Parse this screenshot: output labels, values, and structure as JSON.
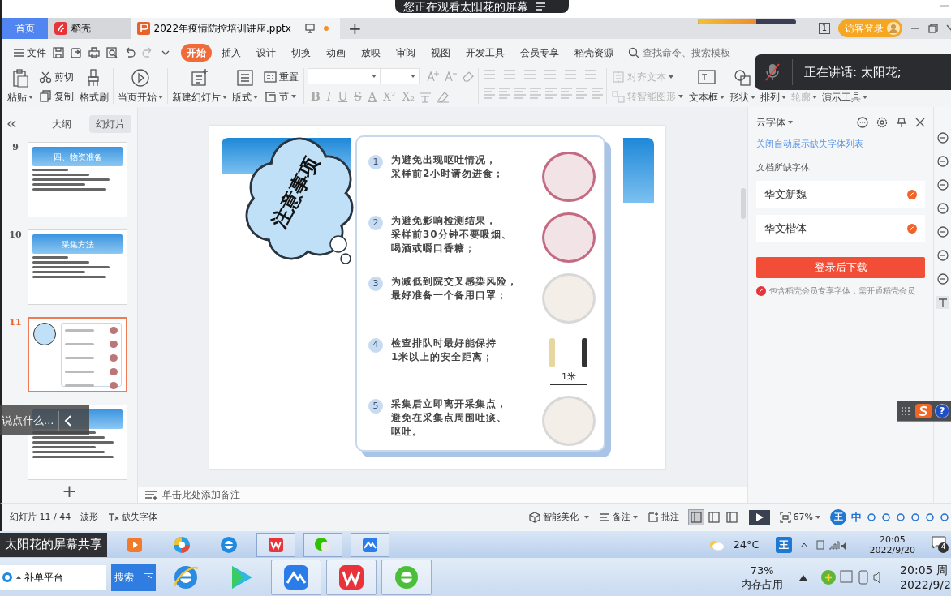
{
  "share_banner": {
    "text": "您正在观看太阳花的屏幕"
  },
  "doc_tabs": [
    {
      "label": "首页",
      "kind": "home",
      "selected": false
    },
    {
      "label": "稻壳",
      "kind": "docer",
      "selected": false
    },
    {
      "label": "2022年疫情防控培训讲座.pptx",
      "kind": "file",
      "selected": true,
      "modified": true
    }
  ],
  "new_tab": "+",
  "load_bar": {
    "level": 0.6
  },
  "screen_badge": "1",
  "login_button": "访客登录",
  "menu": {
    "file": "文件",
    "tabs": [
      {
        "label": "开始",
        "selected": true
      },
      {
        "label": "插入",
        "selected": false
      },
      {
        "label": "设计",
        "selected": false
      },
      {
        "label": "切换",
        "selected": false
      },
      {
        "label": "动画",
        "selected": false
      },
      {
        "label": "放映",
        "selected": false
      },
      {
        "label": "审阅",
        "selected": false
      },
      {
        "label": "视图",
        "selected": false
      },
      {
        "label": "开发工具",
        "selected": false
      },
      {
        "label": "会员专享",
        "selected": false
      },
      {
        "label": "稻壳资源",
        "selected": false
      }
    ],
    "search": {
      "placeholder": "查找命令、搜索模板"
    }
  },
  "ribbon": [
    {
      "kind": "large",
      "label": "粘贴",
      "dropdown": true
    },
    {
      "kind": "stack",
      "items": [
        {
          "label": "剪切",
          "dropdown": false,
          "disabled": false
        },
        {
          "label": "复制",
          "dropdown": false,
          "disabled": false
        }
      ]
    },
    {
      "kind": "large",
      "label": "格式刷",
      "dropdown": false
    },
    {
      "kind": "large",
      "label": "当页开始",
      "dropdown": true
    },
    {
      "kind": "large",
      "label": "新建幻灯片",
      "dropdown": true
    },
    {
      "kind": "large",
      "label": "版式",
      "dropdown": true
    },
    {
      "kind": "stack",
      "items": [
        {
          "label": "重置",
          "dropdown": false,
          "disabled": false
        },
        {
          "label": "节",
          "dropdown": true,
          "disabled": false
        }
      ]
    },
    {
      "kind": "font",
      "buttons": [
        "B",
        "I",
        "U",
        "S",
        "A",
        "X²",
        "X₂"
      ]
    },
    {
      "kind": "paragraph"
    },
    {
      "kind": "stack",
      "items": [
        {
          "label": "对齐文本",
          "dropdown": true,
          "disabled": true
        },
        {
          "label": "转智能图形",
          "dropdown": true,
          "disabled": true
        }
      ]
    },
    {
      "kind": "large",
      "label": "文本框",
      "dropdown": true
    },
    {
      "kind": "large",
      "label": "形状",
      "dropdown": true
    },
    {
      "kind": "large",
      "label": "排列",
      "dropdown": true
    },
    {
      "kind": "large",
      "label": "轮廓",
      "dropdown": true,
      "disabled": true
    },
    {
      "kind": "large",
      "label": "演示工具",
      "dropdown": true
    }
  ],
  "speaking_toast": {
    "text": "正在讲话: 太阳花;",
    "muted": true
  },
  "panel_tabs": [
    {
      "label": "大纲",
      "selected": false
    },
    {
      "label": "幻灯片",
      "selected": true
    }
  ],
  "thumbnails": [
    {
      "number": "9",
      "title": "四、物资准备",
      "kind": "list",
      "selected": false
    },
    {
      "number": "10",
      "title": "采集方法",
      "kind": "list",
      "selected": false
    },
    {
      "number": "11",
      "kind": "cloud",
      "selected": true
    },
    {
      "kind": "text",
      "selected": false
    }
  ],
  "add_slide": "+",
  "chat_input": {
    "placeholder": "说点什么..."
  },
  "slide": {
    "title": "注意事项",
    "items": [
      {
        "number": "1",
        "lines": [
          "为避免出现呕吐情况，",
          "采样前2小时请勿进食；"
        ]
      },
      {
        "number": "2",
        "lines": [
          "为避免影响检测结果，",
          "采样前30分钟不要吸烟、",
          "喝酒或嚼口香糖；"
        ]
      },
      {
        "number": "3",
        "lines": [
          "为减低到院交叉感染风险，",
          "最好准备一个备用口罩；"
        ]
      },
      {
        "number": "4",
        "lines": [
          "检查排队时最好能保持",
          "1米以上的安全距离；"
        ],
        "caption": "1米"
      },
      {
        "number": "5",
        "lines": [
          "采集后立即离开采集点，",
          "避免在采集点周围吐痰、",
          "呕吐。"
        ]
      }
    ]
  },
  "notes": {
    "placeholder": "单击此处添加备注"
  },
  "font_pane": {
    "title": "云字体",
    "link": "关闭自动展示缺失字体列表",
    "section": "文档所缺字体",
    "fonts": [
      "华文新魏",
      "华文楷体"
    ],
    "button": "登录后下载",
    "note": "包含稻壳会员专享字体，需开通稻壳会员"
  },
  "ime_float": {
    "help": "?"
  },
  "status": {
    "slide": "幻灯片 11 / 44",
    "theme": "波形",
    "missing_fonts": "缺失字体",
    "beautify": "智能美化",
    "notes": "备注",
    "comments": "批注",
    "views": [
      {
        "selected": true
      },
      {
        "selected": false
      },
      {
        "selected": false
      }
    ],
    "zoom": "67%"
  },
  "ime_toolbar": {
    "logo": "王",
    "mode": "中"
  },
  "remote_taskbar": {
    "share_label": "太阳花的屏幕共享",
    "weather": "24°C",
    "time": "20:05",
    "date": "2022/9/20",
    "notifications": "4",
    "ime_logo": "王"
  },
  "local_taskbar": {
    "search": {
      "value": "补单平台"
    },
    "search_button": "搜索一下",
    "memory_percent": "73%",
    "memory_label": "内存占用",
    "time": "20:05 周",
    "date": "2022/9/2"
  }
}
